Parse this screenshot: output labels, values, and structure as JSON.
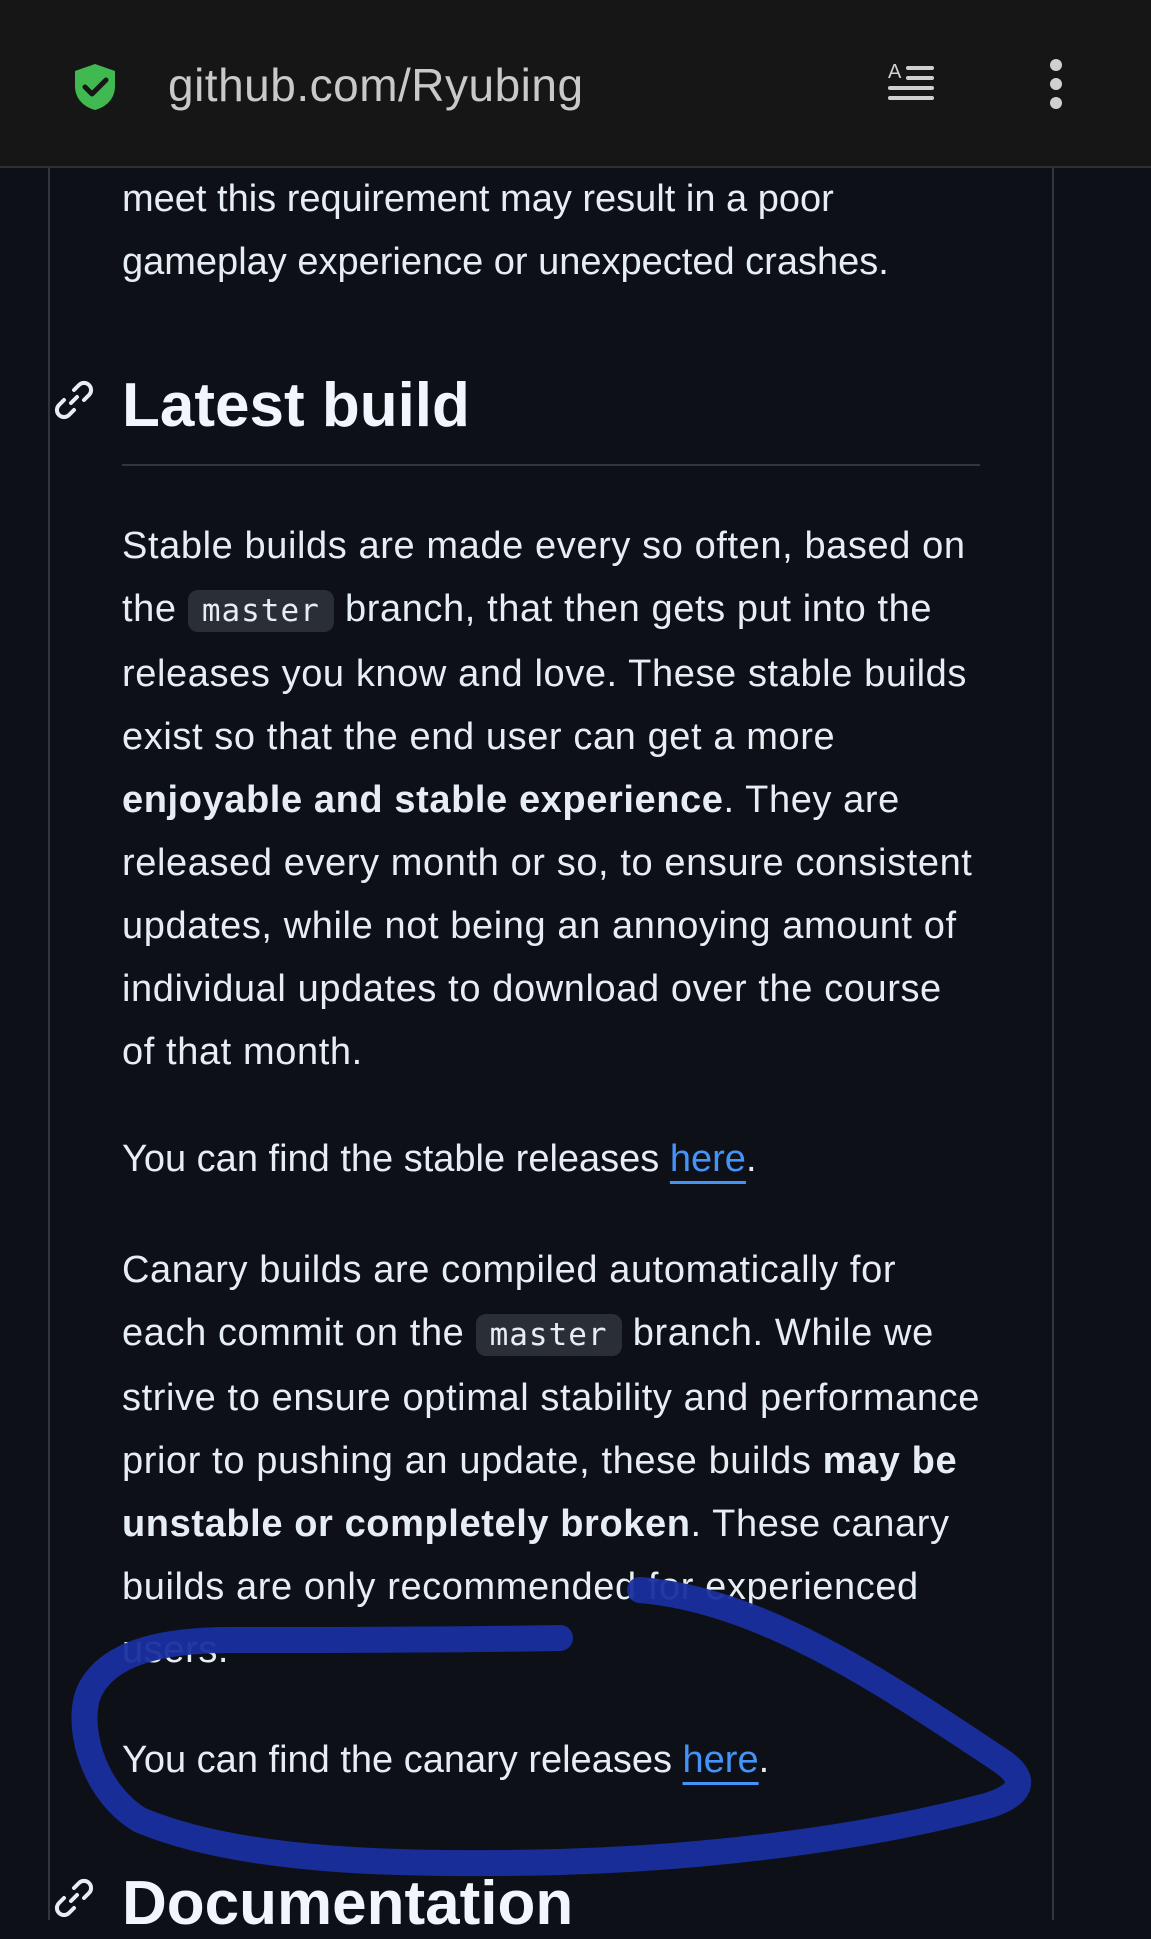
{
  "browser": {
    "url": "github.com/Ryubing",
    "accent_color": "#3fb950",
    "icons": [
      "shield-check-icon",
      "reader-mode-icon",
      "more-vert-icon"
    ]
  },
  "article": {
    "intro_text": "meet this requirement may result in a poor gameplay experience or unexpected crashes.",
    "section_heading": "Latest build",
    "stable": {
      "p1": "Stable builds are made every so often, based on the",
      "code": "master",
      "p2": "branch, that then gets put into the releases you know and love. These stable builds exist so that the end user can get a more",
      "bold": "enjoyable and stable experience",
      "p3": ". They are released every month or so, to ensure consistent updates, while not being an annoying amount of individual updates to download over the course of that month."
    },
    "stable_find": {
      "text": "You can find the stable releases",
      "link": "here",
      "end": "."
    },
    "canary": {
      "p1": "Canary builds are compiled automatically for each commit on the",
      "code": "master",
      "p2": "branch. While we strive to ensure optimal stability and performance prior to pushing an update, these builds",
      "bold": "may be unstable or completely broken",
      "p3": ". These canary builds are only recommended for experienced users."
    },
    "canary_find": {
      "text": "You can find the canary releases",
      "link": "here",
      "end": "."
    },
    "next_heading": "Documentation",
    "link_color": "#4493f8",
    "annotation_color": "#1a2fa0"
  }
}
